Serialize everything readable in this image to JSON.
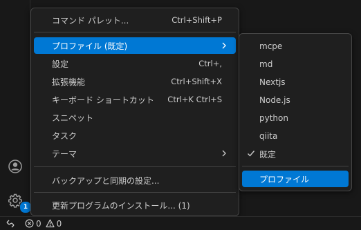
{
  "colors": {
    "accent": "#0078d4",
    "menu_bg": "#1f1f1f",
    "border": "#454545"
  },
  "main_menu": {
    "items": [
      {
        "label": "コマンド パレット...",
        "shortcut": "Ctrl+Shift+P"
      },
      {
        "label": "プロファイル (既定)",
        "has_submenu": true,
        "selected": true
      },
      {
        "label": "設定",
        "shortcut": "Ctrl+,"
      },
      {
        "label": "拡張機能",
        "shortcut": "Ctrl+Shift+X"
      },
      {
        "label": "キーボード ショートカット",
        "shortcut": "Ctrl+K Ctrl+S"
      },
      {
        "label": "スニペット"
      },
      {
        "label": "タスク"
      },
      {
        "label": "テーマ",
        "has_submenu": true
      },
      {
        "label": "バックアップと同期の設定..."
      },
      {
        "label": "更新プログラムのインストール... (1)"
      }
    ]
  },
  "profile_menu": {
    "items": [
      {
        "label": "mcpe"
      },
      {
        "label": "md"
      },
      {
        "label": "Nextjs"
      },
      {
        "label": "Node.js"
      },
      {
        "label": "python"
      },
      {
        "label": "qiita"
      },
      {
        "label": "既定",
        "checked": true
      },
      {
        "label": "プロファイル",
        "selected": true
      }
    ]
  },
  "activity_bar": {
    "accounts_icon": "account-icon",
    "manage_icon": "gear-icon",
    "manage_badge": "1"
  },
  "status_bar": {
    "remote_icon": "remote-icon",
    "errors": "0",
    "warnings": "0"
  }
}
